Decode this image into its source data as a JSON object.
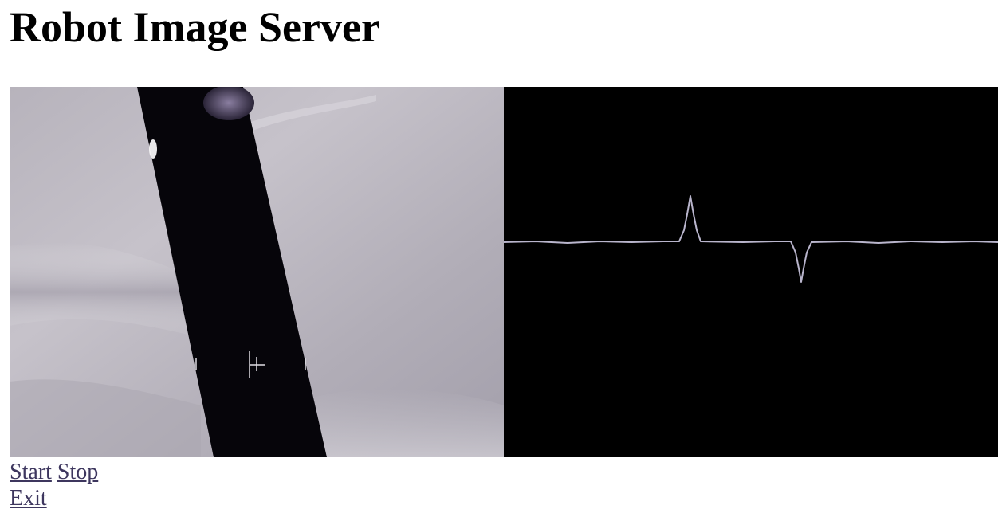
{
  "page": {
    "title": "Robot Image Server"
  },
  "camera_feed": {
    "image_icon": "camera-frame-image"
  },
  "signal_plot": {
    "image_icon": "signal-trace-image"
  },
  "links": {
    "start": "Start",
    "stop": "Stop",
    "exit": "Exit"
  }
}
